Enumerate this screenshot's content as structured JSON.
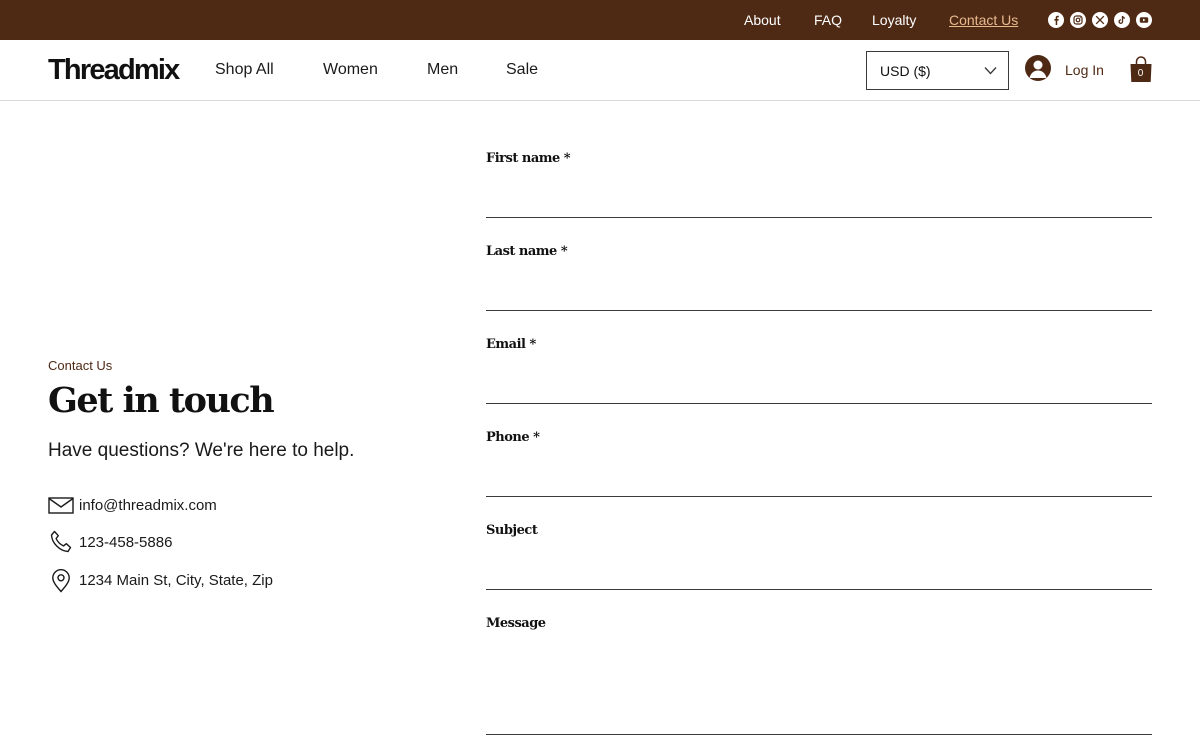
{
  "topbar": {
    "links": [
      {
        "label": "About"
      },
      {
        "label": "FAQ"
      },
      {
        "label": "Loyalty"
      },
      {
        "label": "Contact Us"
      }
    ],
    "social_icons": [
      "facebook-icon",
      "instagram-icon",
      "x-icon",
      "tiktok-icon",
      "youtube-icon"
    ],
    "background": "#4e2a15"
  },
  "header": {
    "logo": "Threadmix",
    "nav": [
      {
        "label": "Shop All"
      },
      {
        "label": "Women"
      },
      {
        "label": "Men"
      },
      {
        "label": "Sale"
      }
    ],
    "currency": {
      "selected": "USD ($)"
    },
    "login_label": "Log In",
    "cart_count": "0"
  },
  "contact": {
    "eyebrow": "Contact Us",
    "title": "Get in touch",
    "subtitle": "Have questions? We're here to help.",
    "email": "info@threadmix.com",
    "phone": "123-458-5886",
    "address": "1234 Main St, City, State, Zip"
  },
  "form": {
    "first_name_label": "First name *",
    "last_name_label": "Last name *",
    "email_label": "Email *",
    "phone_label": "Phone *",
    "subject_label": "Subject",
    "message_label": "Message"
  },
  "colors": {
    "brand_brown": "#4e2a15",
    "active_link": "#e8b98f"
  }
}
